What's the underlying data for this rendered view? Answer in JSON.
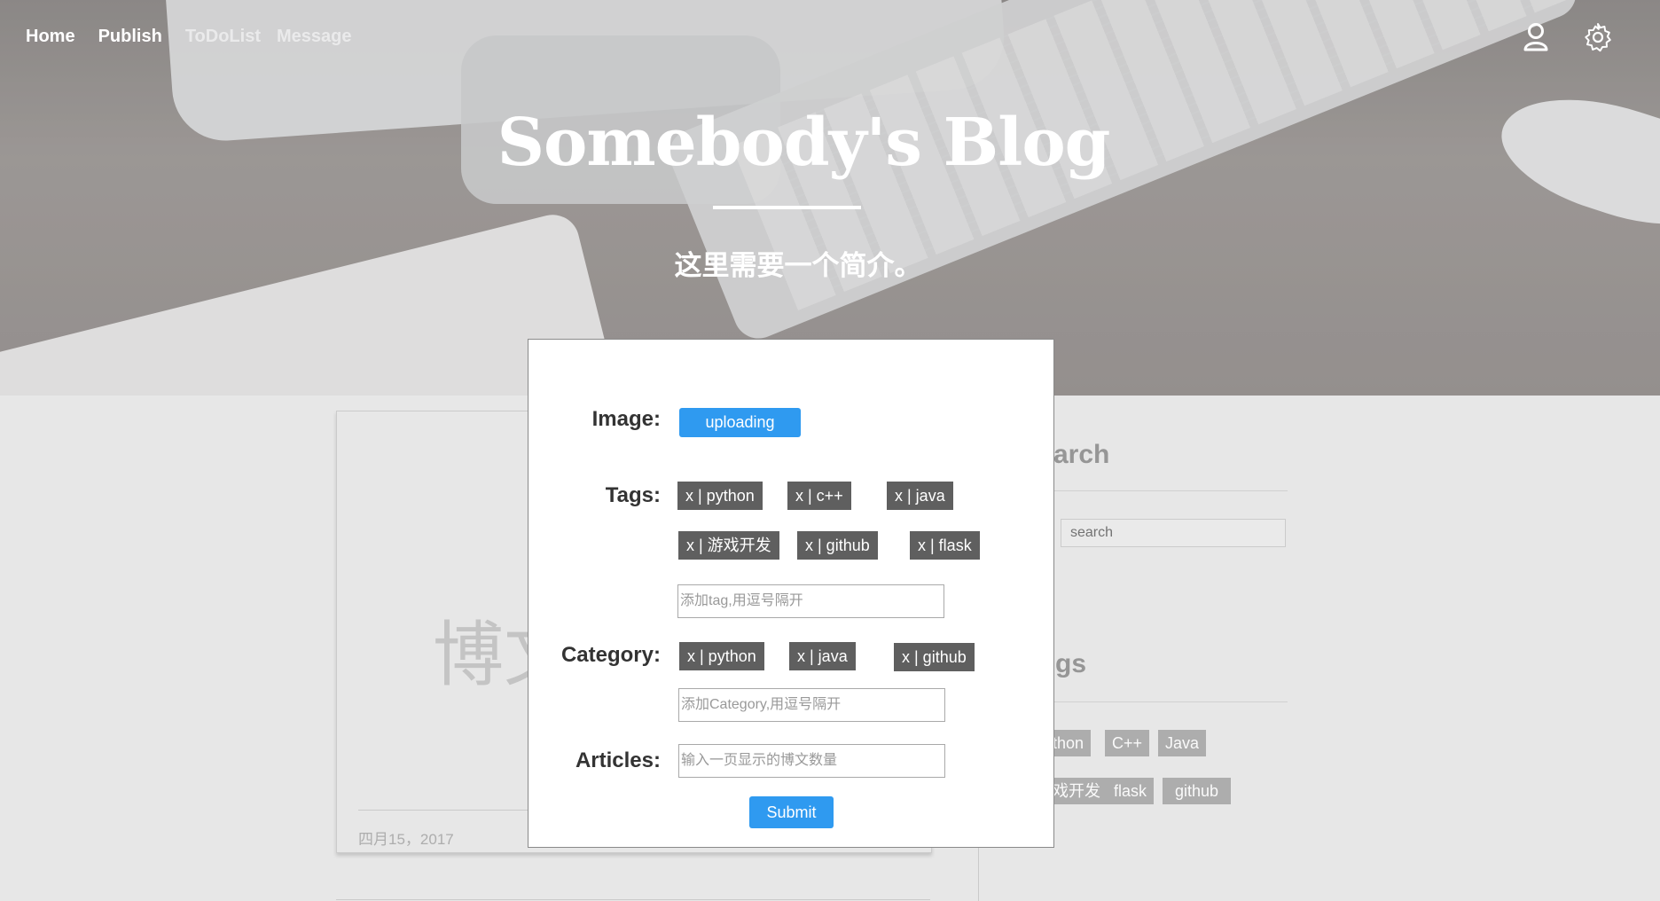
{
  "nav": {
    "items": [
      {
        "label": "Home"
      },
      {
        "label": "Publish"
      },
      {
        "label": "ToDoList"
      },
      {
        "label": "Message"
      }
    ],
    "icons": [
      "user-icon",
      "gear-icon"
    ]
  },
  "hero": {
    "title": "Somebody's Blog",
    "subtitle": "这里需要一个简介。"
  },
  "post": {
    "title_partial": "博文",
    "date": "四月15，2017"
  },
  "sidebar": {
    "search_heading": "arch",
    "search_placeholder": "search",
    "tags_heading": "gs",
    "tags": [
      "thon",
      "C++",
      "Java",
      "戏开发",
      "flask",
      "github"
    ]
  },
  "modal": {
    "image_label": "Image:",
    "upload_button": "uploading",
    "tags_label": "Tags:",
    "tags": [
      "x | python",
      "x | c++",
      "x | java",
      "x | 游戏开发",
      "x | github",
      "x | flask"
    ],
    "tag_input_placeholder": "添加tag,用逗号隔开",
    "category_label": "Category:",
    "categories": [
      "x | python",
      "x | java",
      "x | github"
    ],
    "category_input_placeholder": "添加Category,用逗号隔开",
    "articles_label": "Articles:",
    "articles_input_placeholder": "输入一页显示的博文数量",
    "submit_button": "Submit"
  },
  "colors": {
    "accent": "#2f9af0",
    "chip": "#5f5f5f",
    "sidebar_tag": "#b1b1b1"
  }
}
